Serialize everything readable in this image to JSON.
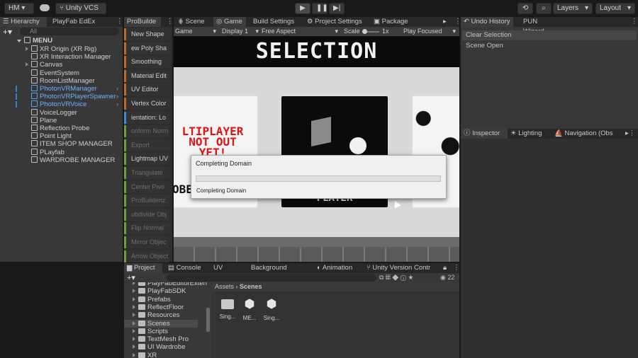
{
  "toolbar": {
    "account": "HM",
    "vcs": "Unity VCS",
    "layers": "Layers",
    "layout": "Layout"
  },
  "hierarchy": {
    "tabs": [
      "Hierarchy",
      "PlayFab EdEx"
    ],
    "search_placeholder": "All",
    "scene": "MENU",
    "items": [
      {
        "label": "XR Origin (XR Rig)",
        "blue": false,
        "arrow": true
      },
      {
        "label": "XR Interaction Manager",
        "blue": false,
        "arrow": false
      },
      {
        "label": "Canvas",
        "blue": false,
        "arrow": true
      },
      {
        "label": "EventSystem",
        "blue": false,
        "arrow": false
      },
      {
        "label": "RoomListManager",
        "blue": false,
        "arrow": false
      },
      {
        "label": "PhotonVRManager",
        "blue": true,
        "arrow": false
      },
      {
        "label": "PhotonVRPlayerSpawner",
        "blue": true,
        "arrow": false
      },
      {
        "label": "PhotonVRVoice",
        "blue": true,
        "arrow": false
      },
      {
        "label": "VoiceLogger",
        "blue": false,
        "arrow": false
      },
      {
        "label": "Plane",
        "blue": false,
        "arrow": false
      },
      {
        "label": "Reflection Probe",
        "blue": false,
        "arrow": false
      },
      {
        "label": "Point Light",
        "blue": false,
        "arrow": false
      },
      {
        "label": "ITEM SHOP MANAGER",
        "blue": false,
        "arrow": false
      },
      {
        "label": "PLayfab",
        "blue": false,
        "arrow": false
      },
      {
        "label": "WARDROBE MANAGER",
        "blue": false,
        "arrow": false
      }
    ]
  },
  "probuilder": {
    "tab": "ProBuilde",
    "items": [
      {
        "label": "New Shape",
        "color": "#c06a2a",
        "dim": false
      },
      {
        "label": "ew Poly Sha",
        "color": "#c06a2a",
        "dim": false
      },
      {
        "label": "Smoothing",
        "color": "#c06a2a",
        "dim": false
      },
      {
        "label": "Material Edit",
        "color": "#c06a2a",
        "dim": false
      },
      {
        "label": "UV Editor",
        "color": "#c06a2a",
        "dim": false
      },
      {
        "label": "Vertex Color",
        "color": "#c06a2a",
        "dim": false
      },
      {
        "label": "ientation: Lo",
        "color": "#3a8ad8",
        "dim": false
      },
      {
        "label": "onform Norm",
        "color": "#6aa03a",
        "dim": true
      },
      {
        "label": "Export",
        "color": "#6aa03a",
        "dim": true
      },
      {
        "label": "Lightmap UV",
        "color": "#6aa03a",
        "dim": false
      },
      {
        "label": "Triangulate",
        "color": "#6aa03a",
        "dim": true
      },
      {
        "label": "Center Pivo",
        "color": "#6aa03a",
        "dim": true
      },
      {
        "label": "ProBuilderiz",
        "color": "#6aa03a",
        "dim": true
      },
      {
        "label": "ubdivide Obj",
        "color": "#6aa03a",
        "dim": true
      },
      {
        "label": "Flip Normal",
        "color": "#6aa03a",
        "dim": true
      },
      {
        "label": "Mirror Objec",
        "color": "#6aa03a",
        "dim": true
      },
      {
        "label": "Arrow Object",
        "color": "#6aa03a",
        "dim": true
      }
    ]
  },
  "center_tabs": [
    "Scene",
    "Game",
    "Build Settings",
    "Project Settings",
    "Package Manager"
  ],
  "game_bar": {
    "mode": "Game",
    "display": "Display 1",
    "aspect": "Free Aspect",
    "scale_label": "Scale",
    "scale_value": "1x",
    "play": "Play Focused"
  },
  "game_view": {
    "title": "SELECTION",
    "card1_text": "LTIPLAYER NOT OUT YET!",
    "card1_side": "OBE",
    "card2_text": "PLAYER"
  },
  "dialog": {
    "title": "Completing Domain",
    "progress": 0.0,
    "status": "Completing Domain"
  },
  "undo": {
    "tabs": [
      "Undo History",
      "PUN Wizard"
    ],
    "items": [
      "Clear Selection",
      "Scene Open"
    ]
  },
  "inspector": {
    "tabs": [
      "Inspector",
      "Lighting",
      "Navigation (Obs"
    ]
  },
  "project": {
    "tabs": [
      "Project",
      "Console",
      "UV Editor",
      "Background Tasks",
      "Animation",
      "Unity Version Contr"
    ],
    "count": "22",
    "breadcrumb": [
      "Assets",
      "Scenes"
    ],
    "tree": [
      "PlayFabEditorExten",
      "PlayFabSDK",
      "Prefabs",
      "ReflectFloor",
      "Resources",
      "Scenes",
      "Scripts",
      "TextMesh Pro",
      "UI Wardrobe",
      "XR"
    ],
    "assets": [
      {
        "label": "Sing...",
        "kind": "folder"
      },
      {
        "label": "ME...",
        "kind": "unity"
      },
      {
        "label": "Sing...",
        "kind": "unity"
      }
    ]
  }
}
